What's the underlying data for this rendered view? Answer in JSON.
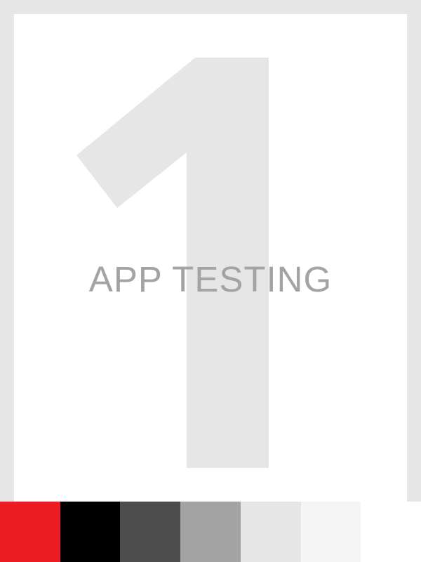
{
  "cover": {
    "numeral": "1",
    "title": "APP TESTING",
    "numeral_color": "#e6e6e6",
    "title_color": "#a3a3a3"
  },
  "palette": [
    {
      "name": "red",
      "color": "#ed1c24"
    },
    {
      "name": "black",
      "color": "#000000"
    },
    {
      "name": "dark-gray",
      "color": "#4d4d4d"
    },
    {
      "name": "mid-gray",
      "color": "#a3a3a3"
    },
    {
      "name": "light-gray",
      "color": "#e6e6e6"
    },
    {
      "name": "off-white",
      "color": "#f5f5f5"
    },
    {
      "name": "white",
      "color": "#ffffff"
    }
  ]
}
